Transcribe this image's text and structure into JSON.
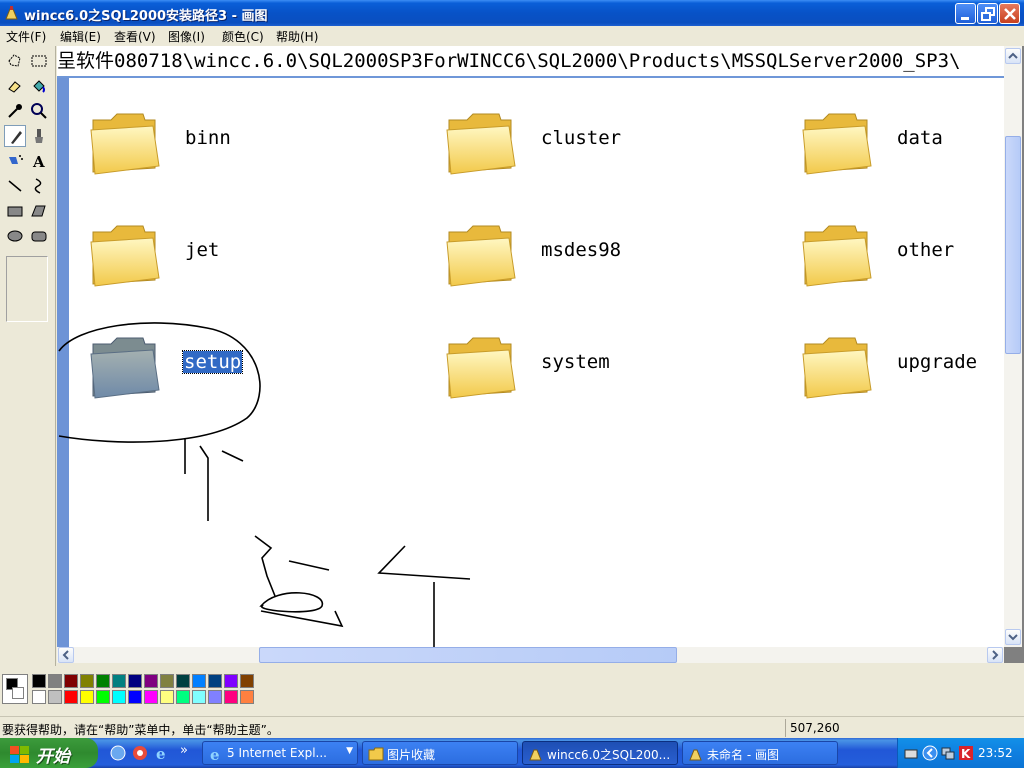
{
  "window": {
    "title": "wincc6.0之SQL2000安装路径3 - 画图"
  },
  "menu": [
    "文件(F)",
    "编辑(E)",
    "查看(V)",
    "图像(I)",
    "颜色(C)",
    "帮助(H)"
  ],
  "canvas": {
    "address_text": "呈软件080718\\wincc.6.0\\SQL2000SP3ForWINCC6\\SQL2000\\Products\\MSSQLServer2000_SP3\\",
    "folders": [
      {
        "name": "binn"
      },
      {
        "name": "cluster"
      },
      {
        "name": "data"
      },
      {
        "name": "jet"
      },
      {
        "name": "msdes98"
      },
      {
        "name": "other"
      },
      {
        "name": "setup"
      },
      {
        "name": "system"
      },
      {
        "name": "upgrade"
      }
    ],
    "selected_folder": "setup"
  },
  "status": {
    "help_text": "要获得帮助，请在“帮助”菜单中，单击“帮助主题”。",
    "coords": "507,260"
  },
  "palette": {
    "foreground": "#000000",
    "background": "#ffffff",
    "row1": [
      "#000000",
      "#808080",
      "#800000",
      "#808000",
      "#008000",
      "#008080",
      "#000080",
      "#800080",
      "#808040",
      "#004040",
      "#0080ff",
      "#004080",
      "#8000ff",
      "#804000"
    ],
    "row2": [
      "#ffffff",
      "#c0c0c0",
      "#ff0000",
      "#ffff00",
      "#00ff00",
      "#00ffff",
      "#0000ff",
      "#ff00ff",
      "#ffff80",
      "#00ff80",
      "#80ffff",
      "#8080ff",
      "#ff0080",
      "#ff8040"
    ]
  },
  "taskbar": {
    "start_label": "开始",
    "tasks": [
      {
        "label": "5 Internet Expl...",
        "icon": "ie-icon"
      },
      {
        "label": "图片收藏",
        "icon": "folder-icon"
      },
      {
        "label": "wincc6.0之SQL200...",
        "icon": "paint-icon"
      },
      {
        "label": "未命名 - 画图",
        "icon": "paint-icon"
      }
    ],
    "clock": "23:52"
  }
}
